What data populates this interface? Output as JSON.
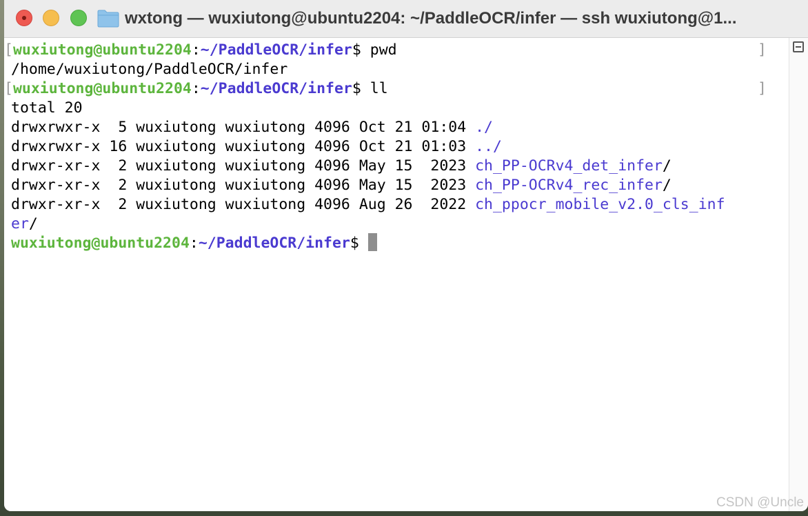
{
  "window": {
    "title": "wxtong — wuxiutong@ubuntu2204: ~/PaddleOCR/infer — ssh wuxiutong@1..."
  },
  "terminal": {
    "prompt_user": "wuxiutong@ubuntu2204",
    "prompt_colon": ":",
    "prompt_path": "~/PaddleOCR/infer",
    "prompt_symbol": "$ ",
    "cmd1": "pwd",
    "pwd_output": "/home/wuxiutong/PaddleOCR/infer",
    "cmd2": "ll",
    "total": "total 20",
    "listing": [
      {
        "meta": "drwxrwxr-x  5 wuxiutong wuxiutong 4096 Oct 21 01:04 ",
        "name": "./",
        "slash": ""
      },
      {
        "meta": "drwxrwxr-x 16 wuxiutong wuxiutong 4096 Oct 21 01:03 ",
        "name": "../",
        "slash": ""
      },
      {
        "meta": "drwxr-xr-x  2 wuxiutong wuxiutong 4096 May 15  2023 ",
        "name": "ch_PP-OCRv4_det_infer",
        "slash": "/"
      },
      {
        "meta": "drwxr-xr-x  2 wuxiutong wuxiutong 4096 May 15  2023 ",
        "name": "ch_PP-OCRv4_rec_infer",
        "slash": "/"
      },
      {
        "meta": "drwxr-xr-x  2 wuxiutong wuxiutong 4096 Aug 26  2022 ",
        "name": "ch_ppocr_mobile_v2.0_cls_inf",
        "slash": ""
      }
    ],
    "wrap_name": "er",
    "wrap_slash": "/",
    "mark_left": "[",
    "mark_right": "]"
  },
  "watermark": "CSDN @Uncle",
  "colors": {
    "user": "#5db53d",
    "path": "#4a3ad0",
    "close": "#ee5a52",
    "minimize": "#f6be4f",
    "maximize": "#5fc454"
  },
  "icons": [
    "close-button",
    "minimize-button",
    "maximize-button",
    "folder-icon",
    "scroll-toggle-icon"
  ]
}
